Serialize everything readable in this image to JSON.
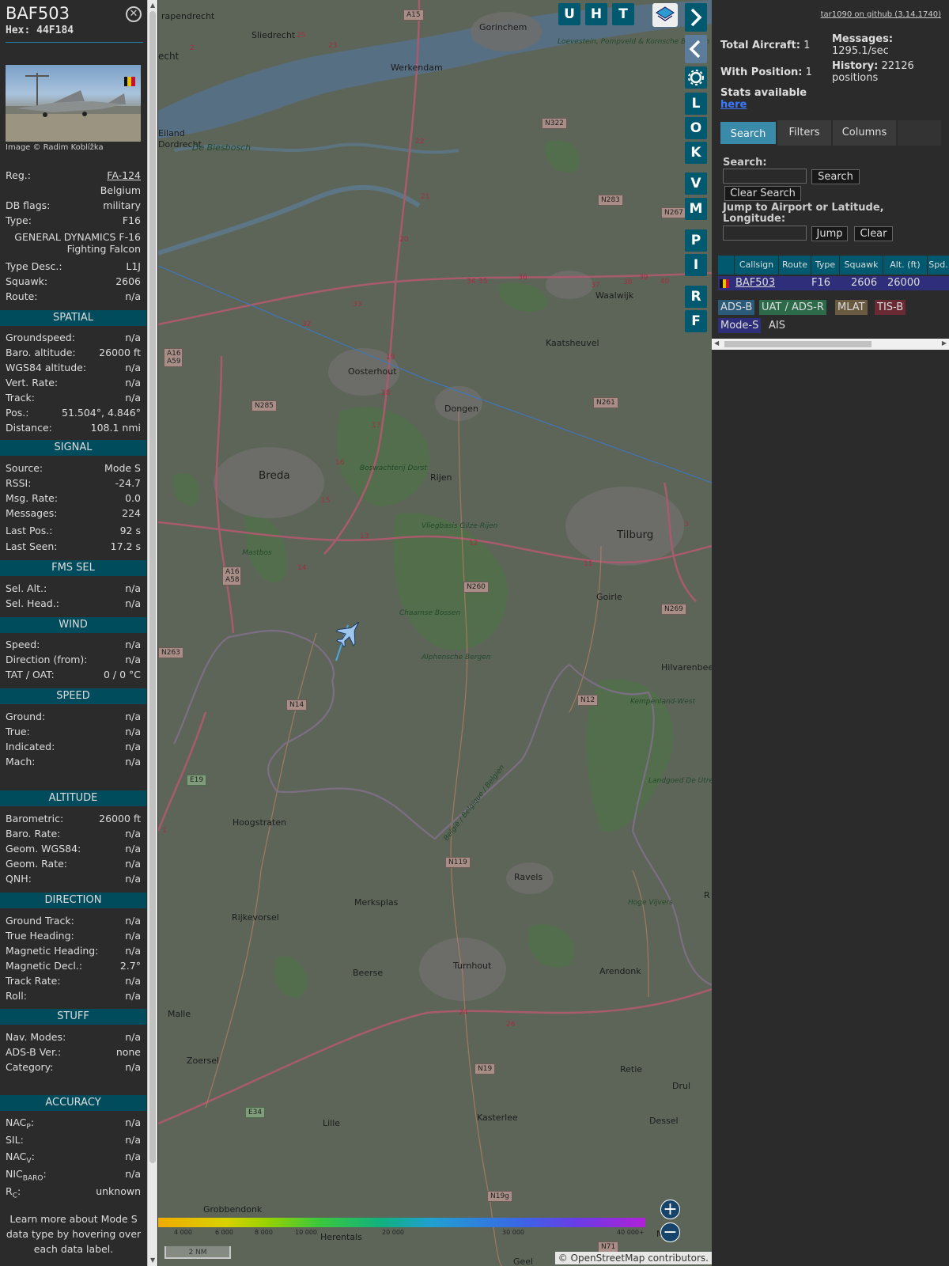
{
  "selected": {
    "callsign": "BAF503",
    "hex": "Hex: 44F184",
    "close_icon": "close-icon",
    "image_credit": "Image © Radim Koblížka",
    "reg_label": "Reg.:",
    "reg": "FA-124",
    "country": "Belgium",
    "dbflags_label": "DB flags:",
    "dbflags": "military",
    "type_label": "Type:",
    "type": "F16",
    "type_name": "GENERAL DYNAMICS F-16 Fighting Falcon",
    "typedesc_label": "Type Desc.:",
    "typedesc": "L1J",
    "squawk_label": "Squawk:",
    "squawk": "2606",
    "route_label": "Route:",
    "route": "n/a"
  },
  "sections": {
    "spatial": {
      "title": "SPATIAL",
      "rows": [
        {
          "l": "Groundspeed:",
          "v": "n/a"
        },
        {
          "l": "Baro. altitude:",
          "v": "26000 ft"
        },
        {
          "l": "WGS84 altitude:",
          "v": "n/a"
        },
        {
          "l": "Vert. Rate:",
          "v": "n/a"
        },
        {
          "l": "Track:",
          "v": "n/a"
        },
        {
          "l": "Pos.:",
          "v": "51.504°, 4.846°"
        },
        {
          "l": "Distance:",
          "v": "108.1 nmi"
        }
      ]
    },
    "signal": {
      "title": "SIGNAL",
      "rows": [
        {
          "l": "Source:",
          "v": "Mode S"
        },
        {
          "l": "RSSI:",
          "v": "-24.7"
        },
        {
          "l": "Msg. Rate:",
          "v": "0.0"
        },
        {
          "l": "Messages:",
          "v": "224"
        },
        {
          "l": "Last Pos.:",
          "v": "92 s"
        },
        {
          "l": "Last Seen:",
          "v": "17.2 s"
        }
      ]
    },
    "fmssel": {
      "title": "FMS SEL",
      "rows": [
        {
          "l": "Sel. Alt.:",
          "v": "n/a"
        },
        {
          "l": "Sel. Head.:",
          "v": "n/a"
        }
      ]
    },
    "wind": {
      "title": "WIND",
      "rows": [
        {
          "l": "Speed:",
          "v": "n/a"
        },
        {
          "l": "Direction (from):",
          "v": "n/a"
        },
        {
          "l": "TAT / OAT:",
          "v": "0 / 0 °C"
        }
      ]
    },
    "speed": {
      "title": "SPEED",
      "rows": [
        {
          "l": "Ground:",
          "v": "n/a"
        },
        {
          "l": "True:",
          "v": "n/a"
        },
        {
          "l": "Indicated:",
          "v": "n/a"
        },
        {
          "l": "Mach:",
          "v": "n/a"
        }
      ]
    },
    "altitude": {
      "title": "ALTITUDE",
      "rows": [
        {
          "l": "Barometric:",
          "v": "26000 ft"
        },
        {
          "l": "Baro. Rate:",
          "v": "n/a"
        },
        {
          "l": "Geom. WGS84:",
          "v": "n/a"
        },
        {
          "l": "Geom. Rate:",
          "v": "n/a"
        },
        {
          "l": "QNH:",
          "v": "n/a"
        }
      ]
    },
    "direction": {
      "title": "DIRECTION",
      "rows": [
        {
          "l": "Ground Track:",
          "v": "n/a"
        },
        {
          "l": "True Heading:",
          "v": "n/a"
        },
        {
          "l": "Magnetic Heading:",
          "v": "n/a"
        },
        {
          "l": "Magnetic Decl.:",
          "v": "2.7°"
        },
        {
          "l": "Track Rate:",
          "v": "n/a"
        },
        {
          "l": "Roll:",
          "v": "n/a"
        }
      ]
    },
    "stuff": {
      "title": "STUFF",
      "rows": [
        {
          "l": "Nav. Modes:",
          "v": "n/a"
        },
        {
          "l": "ADS-B Ver.:",
          "v": "none"
        },
        {
          "l": "Category:",
          "v": "n/a"
        }
      ]
    },
    "accuracy": {
      "title": "ACCURACY",
      "rows": [
        {
          "l": "NAC",
          "sub": "P",
          "v": "n/a"
        },
        {
          "l": "SIL:",
          "sub": "",
          "v": "n/a"
        },
        {
          "l": "NAC",
          "sub": "V",
          "v": "n/a"
        },
        {
          "l": "NIC",
          "sub": "BARO",
          "v": "n/a"
        },
        {
          "l": "R",
          "sub": "C",
          "v": "unknown"
        }
      ]
    }
  },
  "learn_more": "Learn more about Mode S data type by hovering over each data label.",
  "map": {
    "buttons": [
      "U",
      "H",
      "T"
    ],
    "side_buttons": [
      "L",
      "O",
      "K",
      "V",
      "M",
      "P",
      "I",
      "R",
      "F"
    ],
    "layers_icon": "layers-icon",
    "settings_icon": "gear-icon",
    "places": [
      "Gorinchem",
      "Sliedrecht",
      "Werkendam",
      "Dordrecht",
      "Oosterhout",
      "Dongen",
      "Breda",
      "Rijen",
      "Tilburg",
      "Waalwijk",
      "Kaatsheuvel",
      "Goirle",
      "Hilvarenbee",
      "Hoogstraten",
      "Merksplas",
      "Rijkevorsel",
      "Ravels",
      "Turnhout",
      "Beerse",
      "Arendonk",
      "Malle",
      "Zoersel",
      "Retie",
      "Lille",
      "Kasterlee",
      "Dessel",
      "Grobbendonk",
      "Herentals",
      "Geel"
    ],
    "small_labels": [
      "rapendrecht",
      "echt",
      "Eiland",
      "Drul",
      "Mol",
      "R"
    ],
    "nature_labels": [
      "Loevestein, Pompveld & Kornsche Boezem",
      "De Biesbosch",
      "Boswachterij Dorst",
      "Vliegbasis Gilze-Rijen",
      "Mastbos",
      "Chaamse Bossen",
      "Alphensche Bergen",
      "Kempenland-West",
      "Landgoed De Utrecht",
      "Hoge Vijvers",
      "België / Belgique / Belgien"
    ],
    "road_shields": [
      "A15",
      "N322",
      "N283",
      "N267",
      "A16 A59",
      "N285",
      "N261",
      "N260",
      "A16 A58",
      "N269",
      "N263",
      "N14",
      "N12",
      "E19",
      "N119",
      "N19",
      "E34",
      "N19g",
      "N71",
      "A15"
    ],
    "road_numbers": [
      "23",
      "25",
      "2",
      "22",
      "21",
      "20",
      "19",
      "18",
      "17",
      "16",
      "15",
      "14",
      "13",
      "12",
      "11",
      "33",
      "32",
      "34",
      "35",
      "36",
      "37",
      "38",
      "39",
      "40",
      "3",
      "1",
      "24",
      "26"
    ],
    "alt_ticks": [
      "4 000",
      "6 000",
      "8 000",
      "10 000",
      "20 000",
      "30 000",
      "40 000+"
    ],
    "scale": "2 NM",
    "attribution": "© OpenStreetMap contributors.",
    "zoom_in": "+",
    "zoom_out": "−"
  },
  "panel": {
    "github": "tar1090 on github (3.14.1740)",
    "total_aircraft_label": "Total Aircraft:",
    "total_aircraft": "1",
    "with_position_label": "With Position:",
    "with_position": "1",
    "messages_label": "Messages:",
    "messages": "1295.1/sec",
    "history_label": "History:",
    "history": "22126 positions",
    "stats_text": "Stats available",
    "stats_link": "here",
    "tabs": [
      "Search",
      "Filters",
      "Columns"
    ],
    "search_label": "Search:",
    "search_button": "Search",
    "clear_search": "Clear Search",
    "jump_label": "Jump to Airport or Latitude, Longitude:",
    "jump_button": "Jump",
    "clear_button": "Clear",
    "columns": [
      "Callsign",
      "Route",
      "Type",
      "Squawk",
      "Alt. (ft)",
      "Spd."
    ],
    "row": {
      "callsign": "BAF503",
      "route": "",
      "type": "F16",
      "squawk": "2606",
      "alt": "26000"
    },
    "sources": [
      "ADS-B",
      "UAT / ADS-R",
      "MLAT",
      "TIS-B",
      "Mode-S",
      "AIS"
    ]
  }
}
